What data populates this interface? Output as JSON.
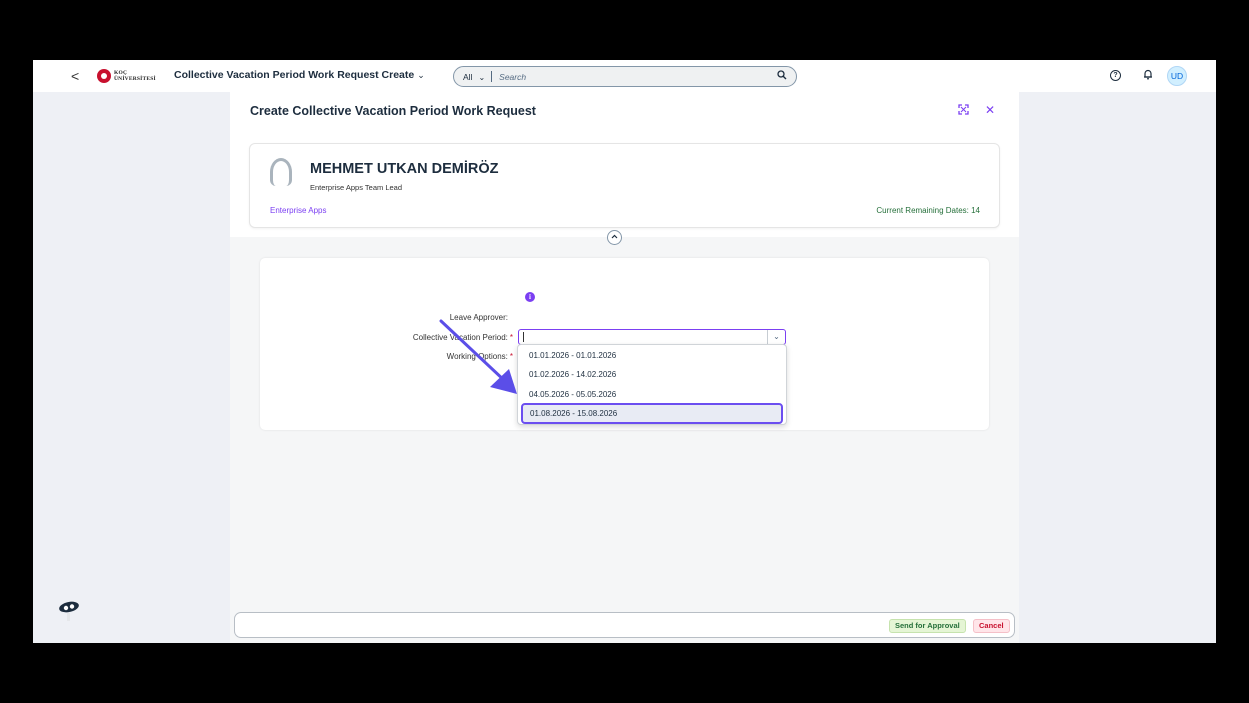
{
  "shellbar": {
    "back": "<",
    "logo_line1": "KOÇ",
    "logo_line2": "ÜNİVERSİTESİ",
    "app_title": "Collective Vacation Period Work Request Create",
    "search_scope": "All",
    "search_placeholder": "Search",
    "avatar_initials": "UD"
  },
  "page": {
    "title": "Create Collective Vacation Period Work Request"
  },
  "profile": {
    "name": "MEHMET UTKAN DEMİRÖZ",
    "role": "Enterprise Apps Team Lead",
    "department": "Enterprise Apps",
    "remaining": "Current Remaining Dates: 14"
  },
  "form": {
    "leave_approver_label": "Leave Approver:",
    "vacation_period_label": "Collective Vacation Period:",
    "working_options_label": "Working Options:",
    "required_mark": "*",
    "period_options": [
      "01.01.2026 - 01.01.2026",
      "01.02.2026 - 14.02.2026",
      "04.05.2026 - 05.05.2026",
      "01.08.2026 - 15.08.2026"
    ],
    "selected_option_index": 3
  },
  "footer": {
    "send_label": "Send for Approval",
    "cancel_label": "Cancel"
  },
  "colors": {
    "accent": "#7b3ff2",
    "arrow": "#5b4ee8",
    "positive": "#256f3a",
    "negative": "#c8102e"
  }
}
